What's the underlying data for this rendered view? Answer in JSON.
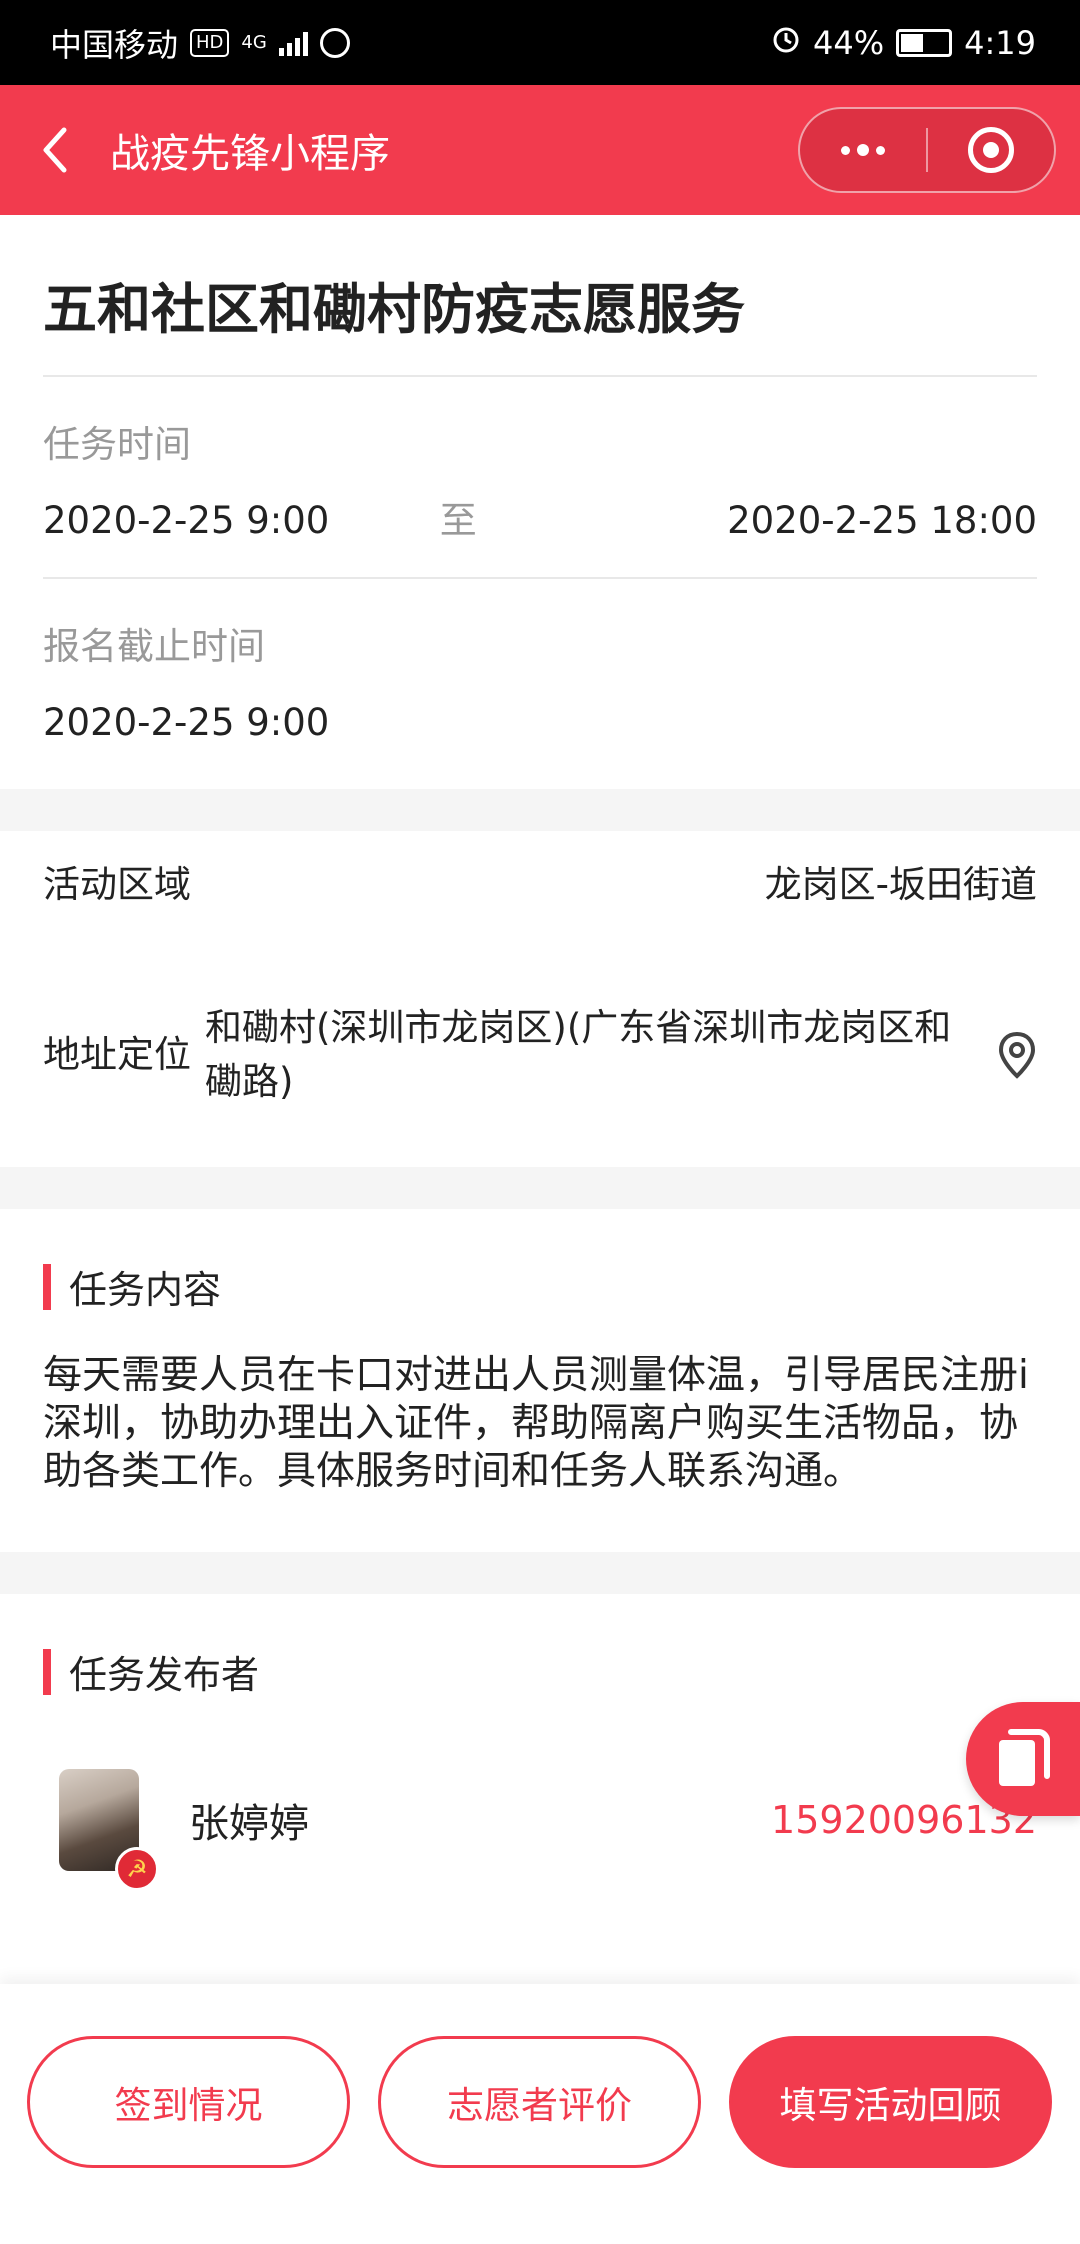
{
  "status_bar": {
    "carrier": "中国移动",
    "hd": "HD",
    "network": "4G",
    "battery": "44%",
    "time": "4:19"
  },
  "navbar": {
    "title": "战疫先锋小程序"
  },
  "task": {
    "title": "五和社区和磡村防疫志愿服务",
    "time_label": "任务时间",
    "start_time": "2020-2-25 9:00",
    "to_text": "至",
    "end_time": "2020-2-25 18:00",
    "deadline_label": "报名截止时间",
    "deadline": "2020-2-25 9:00"
  },
  "location": {
    "area_label": "活动区域",
    "area_value": "龙岗区-坂田街道",
    "address_label": "地址定位",
    "address_value": "和磡村(深圳市龙岗区)(广东省深圳市龙岗区和磡路)"
  },
  "content_section": {
    "heading": "任务内容",
    "text": "每天需要人员在卡口对进出人员测量体温，引导居民注册i深圳，协助办理出入证件，帮助隔离户购买生活物品，协助各类工作。具体服务时间和任务人联系沟通。"
  },
  "publisher_section": {
    "heading": "任务发布者",
    "name": "张婷婷",
    "phone": "15920096132"
  },
  "footer": {
    "checkin_label": "签到情况",
    "review_label": "志愿者评价",
    "fill_review_label": "填写活动回顾"
  },
  "colors": {
    "accent": "#f23b4e",
    "muted_text": "#999999",
    "section_gap": "#f5f5f5"
  },
  "icons": [
    "back-icon",
    "more-icon",
    "close-miniprogram-icon",
    "location-pin-icon",
    "copy-icon",
    "party-badge-icon"
  ]
}
